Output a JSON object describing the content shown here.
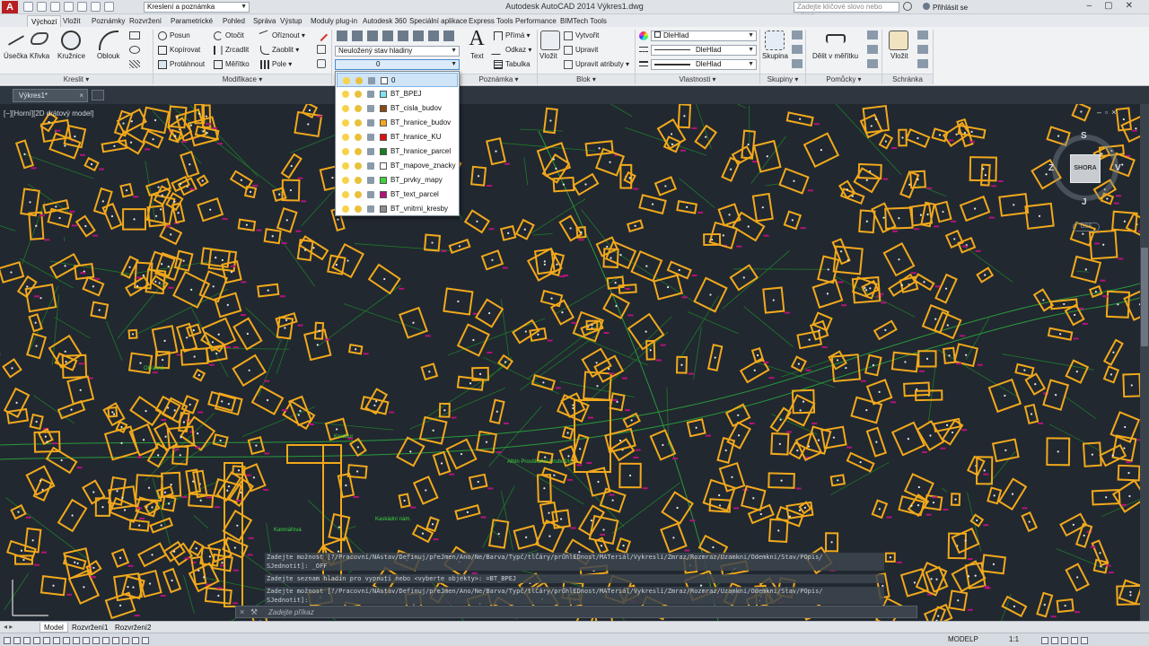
{
  "app": {
    "title": "Autodesk AutoCAD 2014   Výkres1.dwg",
    "workspace": "Kreslení a poznámka",
    "search_placeholder": "Zadejte klíčové slovo nebo výraz.",
    "signin": "Přihlásit se"
  },
  "ribbon_tabs": [
    "Výchozí",
    "Vložit",
    "Poznámky",
    "Rozvržení",
    "Parametrické",
    "Pohled",
    "Správa",
    "Výstup",
    "Moduly plug-in",
    "Autodesk 360",
    "Speciální aplikace",
    "Express Tools",
    "Performance",
    "BIMTech Tools"
  ],
  "draw": {
    "line": "Úsečka",
    "polyline": "Křivka",
    "circle": "Kružnice",
    "arc": "Oblouk",
    "title": "Kreslit ▾"
  },
  "modify": {
    "move": "Posun",
    "copy": "Kopírovat",
    "stretch": "Protáhnout",
    "rotate": "Otočit",
    "mirror": "Zrcadlit",
    "scale": "Měřítko",
    "trim": "Oříznout ▾",
    "fillet": "Zaoblit ▾",
    "array": "Pole ▾",
    "title": "Modifikace ▾"
  },
  "layers": {
    "state": "Neuložený stav hladiny",
    "current": "0"
  },
  "annotation": {
    "text": "Text",
    "linear": "Přímá ▾",
    "leader": "Odkaz ▾",
    "table": "Tabulka",
    "title": "Poznámka ▾"
  },
  "block": {
    "insert": "Vložit",
    "create": "Vytvořit",
    "edit": "Upravit",
    "edit_attr": "Upravit atributy ▾",
    "title": "Blok ▾"
  },
  "properties": {
    "color": "DleHlad",
    "linetype": "DleHlad",
    "lineweight": "DleHlad",
    "title": "Vlastnosti ▾"
  },
  "groups": {
    "group": "Skupina",
    "title": "Skupiny ▾"
  },
  "utilities": {
    "measure": "Dělit v měřítku",
    "title": "Pomůcky ▾"
  },
  "clipboard": {
    "paste": "Vložit",
    "title": "Schránka"
  },
  "doc_tab": "Výkres1*",
  "viewport_label": "[−][Horní][2D drátový model]",
  "layer_list": [
    {
      "name": "0",
      "color": "#ffffff"
    },
    {
      "name": "BT_BPEJ",
      "color": "#7fe3f2"
    },
    {
      "name": "BT_cisla_budov",
      "color": "#8a4a12"
    },
    {
      "name": "BT_hranice_budov",
      "color": "#f2a91c"
    },
    {
      "name": "BT_hranice_KU",
      "color": "#e01010"
    },
    {
      "name": "BT_hranice_parcel",
      "color": "#1d7d1d"
    },
    {
      "name": "BT_mapove_znacky",
      "color": "#ffffff"
    },
    {
      "name": "BT_prvky_mapy",
      "color": "#3fd23f"
    },
    {
      "name": "BT_text_parcel",
      "color": "#b2137a"
    },
    {
      "name": "BT_vnitrni_kresby",
      "color": "#8c8c8c"
    }
  ],
  "viewcube": {
    "top": "SHORA",
    "n": "S",
    "s": "J",
    "e": "V",
    "w": "Z",
    "wcs": "GSS"
  },
  "command_history": [
    "Zadejte možnost [?/Pracovní/NAstav/Definuj/přeJmen/Ano/Ne/Barva/Typč/tlČáry/průhlEDnost/MATeriál/Vykreslí/Zmraz/Rozmraz/Uzamkni/Odemkni/Stav/POpis/",
    "SJednotit]: _OFF",
    "Zadejte seznam hladin pro vypnutí nebo <vyberte objekty>: =BT_BPEJ",
    "Zadejte možnost [?/Pracovní/NAstav/Definuj/přeJmen/Ano/Ne/Barva/Typč/tlČáry/průhlEDnost/MATeriál/Vykreslí/Zmraz/Rozmraz/Uzamkni/Odemkni/Stav/POpis/",
    "SJednotit]:"
  ],
  "command_prompt": "Zadejte příkaz",
  "layout_tabs": [
    "Model",
    "Rozvržení1",
    "Rozvržení2"
  ],
  "status": {
    "space": "MODELP",
    "scale": "1:1"
  },
  "map_labels": [
    "Kamnářova",
    "Kaskádní nám.",
    "Albín Prouška/lní Hrubců/lo",
    "Kredbur",
    "Okrasná"
  ]
}
